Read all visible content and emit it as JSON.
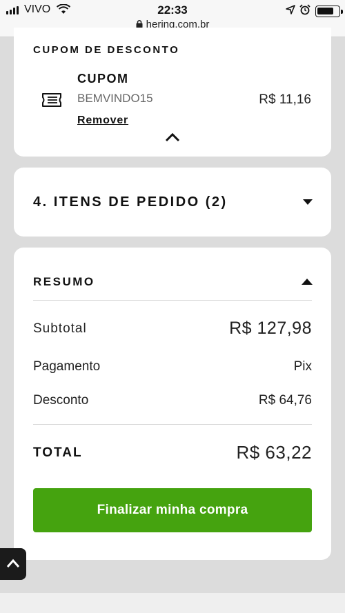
{
  "status_bar": {
    "carrier": "VIVO",
    "time": "22:33",
    "url": "hering.com.br"
  },
  "coupon": {
    "section_title": "CUPOM DE DESCONTO",
    "label": "CUPOM",
    "code": "BEMVINDO15",
    "value": "R$ 11,16",
    "remove_label": "Remover",
    "icon": "ticket-icon"
  },
  "items": {
    "section_title": "4. ITENS DE PEDIDO (2)"
  },
  "summary": {
    "section_title": "RESUMO",
    "rows": [
      {
        "label": "Subtotal",
        "value": "R$ 127,98"
      },
      {
        "label": "Pagamento",
        "value": "Pix"
      },
      {
        "label": "Desconto",
        "value": "R$ 64,76"
      }
    ],
    "total_label": "TOTAL",
    "total_value": "R$ 63,22",
    "cta_label": "Finalizar minha compra"
  },
  "colors": {
    "cta": "#45a30f",
    "background": "#dcdcdc",
    "card": "#ffffff"
  }
}
